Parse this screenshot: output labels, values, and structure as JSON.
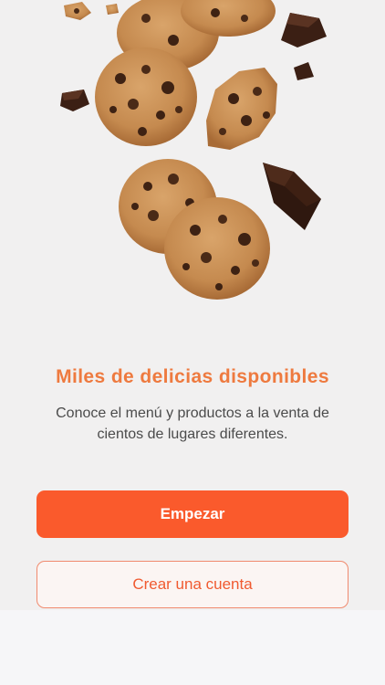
{
  "onboarding": {
    "headline": "Miles de delicias disponibles",
    "subtitle": "Conoce el menú  y productos a la venta de cientos de lugares diferentes.",
    "hero_illustration": "chocolate-chip-cookies",
    "primary_button": {
      "label": "Empezar"
    },
    "secondary_button": {
      "label": "Crear una cuenta"
    }
  },
  "colors": {
    "accent": "#fa5a2c",
    "headline": "#ee7a3f",
    "background": "#f1f0f0"
  }
}
